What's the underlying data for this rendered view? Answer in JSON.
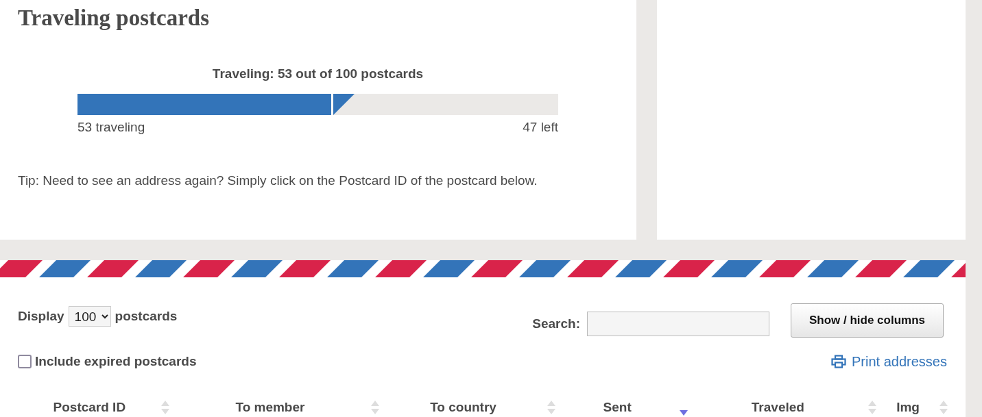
{
  "title": "Traveling postcards",
  "progress": {
    "caption": "Traveling: 53 out of 100 postcards",
    "level": 0.53,
    "traveling_label": "53 traveling",
    "left_label": "47 left"
  },
  "tip": "Tip: Need to see an address again? Simply click on the Postcard ID of the postcard below.",
  "display": {
    "label": "Display",
    "value": "100",
    "suffix": "postcards"
  },
  "search": {
    "label": "Search:"
  },
  "columns_button": "Show / hide columns",
  "include_expired": {
    "label": "Include expired postcards",
    "checked": false
  },
  "print_link": "Print addresses",
  "table": {
    "columns": [
      {
        "label": "Postcard ID",
        "sorted": false
      },
      {
        "label": "To member",
        "sorted": false
      },
      {
        "label": "To country",
        "sorted": false
      },
      {
        "label": "Sent",
        "sorted": true
      },
      {
        "label": "Traveled",
        "sorted": false
      },
      {
        "label": "Img",
        "sorted": false
      }
    ]
  }
}
